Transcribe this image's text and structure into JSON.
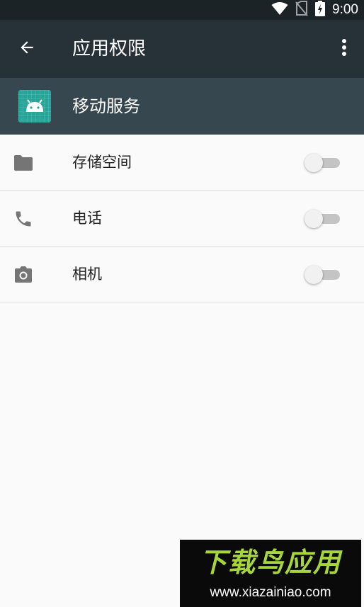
{
  "status_bar": {
    "time": "9:00",
    "icons": [
      "wifi-icon",
      "no-sim-icon",
      "battery-charging-icon"
    ]
  },
  "app_bar": {
    "title": "应用权限",
    "back_icon": "arrow-back-icon",
    "menu_icon": "more-vert-icon"
  },
  "app_header": {
    "app_name": "移动服务",
    "app_icon": "android-icon"
  },
  "permissions": [
    {
      "label": "存储空间",
      "icon": "folder-icon",
      "enabled": false
    },
    {
      "label": "电话",
      "icon": "phone-icon",
      "enabled": false
    },
    {
      "label": "相机",
      "icon": "camera-icon",
      "enabled": false
    }
  ],
  "watermark": {
    "logo_text": "下载鸟应用",
    "url": "www.xiazainiao.com"
  },
  "colors": {
    "status_bar": "#1c2326",
    "app_bar": "#263238",
    "app_header": "#37474f",
    "app_icon": "#26a69a",
    "background": "#fafafa",
    "watermark_green": "#a7d63a"
  }
}
